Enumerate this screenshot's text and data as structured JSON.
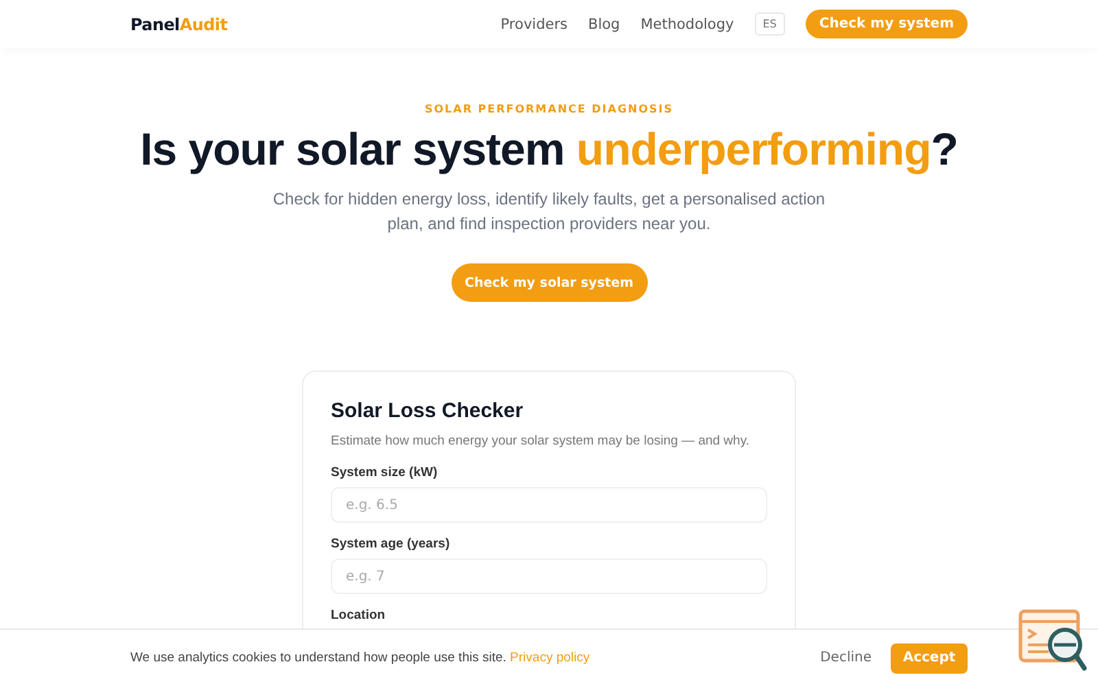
{
  "nav": {
    "logo_first": "Panel",
    "logo_second": "Audit",
    "links": [
      "Providers",
      "Blog",
      "Methodology"
    ],
    "language": "ES",
    "cta": "Check my system"
  },
  "hero": {
    "eyebrow": "SOLAR PERFORMANCE DIAGNOSIS",
    "title_start": "Is your solar system ",
    "title_highlight": "underperforming",
    "title_end": "?",
    "subtitle": "Check for hidden energy loss, identify likely faults, get a personalised action plan, and find inspection providers near you.",
    "button": "Check my solar system"
  },
  "checker": {
    "title": "Solar Loss Checker",
    "description": "Estimate how much energy your solar system may be losing — and why.",
    "fields": [
      {
        "label": "System size (kW)",
        "placeholder": "e.g. 6.5"
      },
      {
        "label": "System age (years)",
        "placeholder": "e.g. 7"
      },
      {
        "label": "Location"
      }
    ]
  },
  "cookie_bar": {
    "text": "We use analytics cookies to understand how people use this site.",
    "link": "Privacy policy",
    "decline": "Decline",
    "accept": "Accept"
  }
}
